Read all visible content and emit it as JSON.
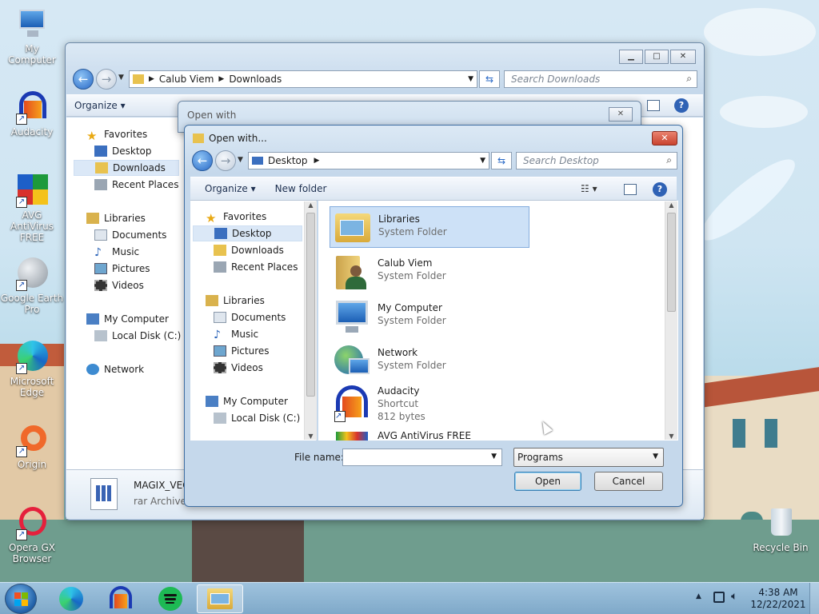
{
  "desktop": {
    "icons": [
      {
        "label": "My Computer"
      },
      {
        "label": "Audacity"
      },
      {
        "label": "AVG AntiVirus FREE"
      },
      {
        "label": "Google Earth Pro"
      },
      {
        "label": "Microsoft Edge"
      },
      {
        "label": "Origin"
      },
      {
        "label": "Opera GX Browser"
      },
      {
        "label": "Recycle Bin"
      }
    ]
  },
  "explorer": {
    "path": [
      "Calub Viem",
      "Downloads"
    ],
    "search_placeholder": "Search Downloads",
    "toolbar": {
      "organize": "Organize"
    },
    "nav": {
      "favorites": "Favorites",
      "desktop": "Desktop",
      "downloads": "Downloads",
      "recent": "Recent Places",
      "libraries": "Libraries",
      "documents": "Documents",
      "music": "Music",
      "pictures": "Pictures",
      "videos": "Videos",
      "computer": "My Computer",
      "localdisk": "Local Disk (C:)",
      "network": "Network"
    },
    "details": {
      "name": "MAGIX_VEG",
      "type": "rar Archive"
    }
  },
  "openwith_bg": {
    "title": "Open with"
  },
  "dialog": {
    "title": "Open with...",
    "path": [
      "Desktop"
    ],
    "search_placeholder": "Search Desktop",
    "toolbar": {
      "organize": "Organize",
      "newfolder": "New folder"
    },
    "nav": {
      "favorites": "Favorites",
      "desktop": "Desktop",
      "downloads": "Downloads",
      "recent": "Recent Places",
      "libraries": "Libraries",
      "documents": "Documents",
      "music": "Music",
      "pictures": "Pictures",
      "videos": "Videos",
      "computer": "My Computer",
      "localdisk": "Local Disk (C:)"
    },
    "files": [
      {
        "name": "Libraries",
        "type": "System Folder"
      },
      {
        "name": "Calub Viem",
        "type": "System Folder"
      },
      {
        "name": "My Computer",
        "type": "System Folder"
      },
      {
        "name": "Network",
        "type": "System Folder"
      },
      {
        "name": "Audacity",
        "type": "Shortcut",
        "size": "812 bytes"
      },
      {
        "name": "AVG AntiVirus FREE"
      }
    ],
    "filename_label": "File name:",
    "filename_value": "",
    "filetype": "Programs",
    "open_label": "Open",
    "cancel_label": "Cancel"
  },
  "taskbar": {
    "time": "4:38 AM",
    "date": "12/22/2021"
  },
  "colors": {
    "accent": "#2969c6",
    "close": "#c9432f",
    "selection": "#cde1f7"
  }
}
